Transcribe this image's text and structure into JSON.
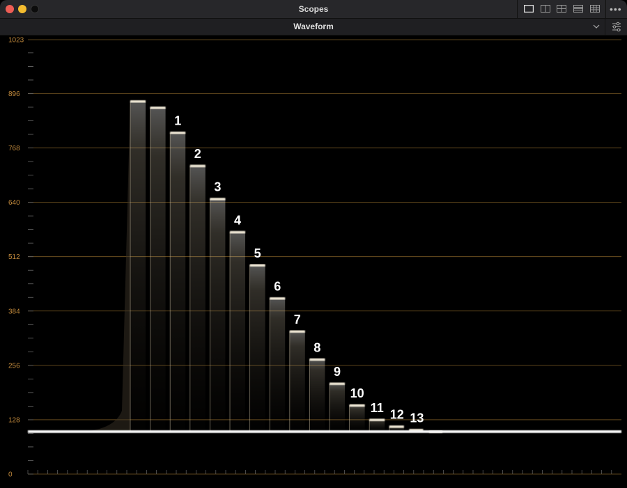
{
  "window": {
    "title": "Scopes"
  },
  "toolbar": {
    "mode": "Waveform"
  },
  "icons": {
    "layouts": [
      "single-view-icon",
      "two-view-icon",
      "quad-view-icon",
      "stacked-view-icon",
      "grid-view-icon"
    ],
    "more": "more-icon",
    "settings": "sliders-icon",
    "dropdown": "chevron-down-icon"
  },
  "scope": {
    "axis_labels": [
      "1023",
      "896",
      "768",
      "640",
      "512",
      "384",
      "256",
      "128",
      "0"
    ],
    "axis_values": [
      1023,
      896,
      768,
      640,
      512,
      384,
      256,
      128,
      0
    ],
    "step_labels": [
      "1",
      "2",
      "3",
      "4",
      "5",
      "6",
      "7",
      "8",
      "9",
      "10",
      "11",
      "12",
      "13"
    ],
    "step_levels": [
      878,
      863,
      804,
      726,
      648,
      570,
      492,
      414,
      336,
      270,
      213,
      162,
      128,
      112,
      104,
      100
    ],
    "noise_floor": 100,
    "colors": {
      "grid": "#7a5a24",
      "label": "#c28a3c",
      "trace": "#f2ead8",
      "background": "#000000"
    }
  }
}
